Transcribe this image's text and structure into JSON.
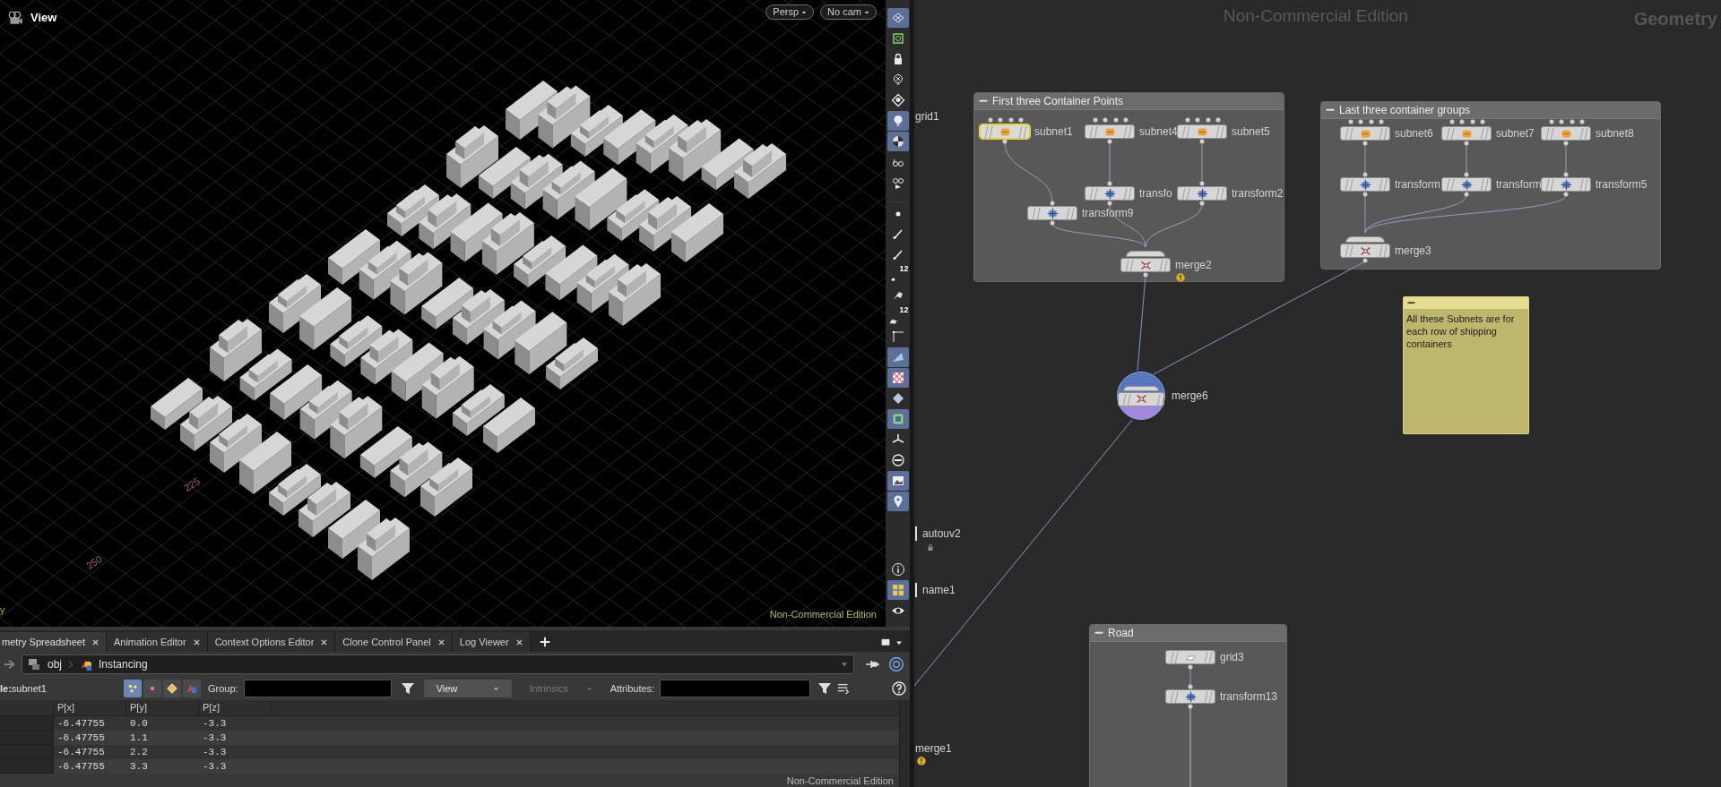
{
  "viewport": {
    "title": "View",
    "menus": [
      {
        "label": "Persp"
      },
      {
        "label": "No cam"
      }
    ],
    "grid_labels": [
      "225",
      "250"
    ],
    "axis_label": "y",
    "edition": "Non-Commercial Edition"
  },
  "toolbar": [
    {
      "kind": "display",
      "selected": true
    },
    {
      "kind": "snap",
      "selected": false
    },
    {
      "kind": "lock",
      "selected": false
    },
    {
      "kind": "light-off",
      "selected": false
    },
    {
      "kind": "light-diamond",
      "selected": false
    },
    {
      "kind": "light",
      "selected": true
    },
    {
      "kind": "sphere",
      "selected": true
    },
    {
      "kind": "glasses",
      "selected": false
    },
    {
      "kind": "glasses-play",
      "selected": false
    },
    {
      "kind": "dot",
      "selected": false
    },
    {
      "kind": "pen",
      "selected": false
    },
    {
      "kind": "pen",
      "selected": false
    },
    {
      "kind": "dot",
      "selected": false,
      "badge": "12"
    },
    {
      "kind": "brush",
      "selected": false
    },
    {
      "kind": "plane",
      "selected": false,
      "badge": "12"
    },
    {
      "kind": "corner",
      "selected": false
    },
    {
      "kind": "shard",
      "selected": true
    },
    {
      "kind": "checker",
      "selected": true
    },
    {
      "kind": "diamond",
      "selected": false
    },
    {
      "kind": "frame",
      "selected": true
    },
    {
      "kind": "axis",
      "selected": false
    },
    {
      "kind": "circle",
      "selected": false
    },
    {
      "kind": "picture",
      "selected": true
    },
    {
      "kind": "pin",
      "selected": true
    },
    {
      "kind": "info",
      "selected": false
    },
    {
      "kind": "layout",
      "selected": true
    },
    {
      "kind": "eye",
      "selected": false
    }
  ],
  "spreadsheet": {
    "tabs": [
      {
        "label": "metry Spreadsheet",
        "selected": true
      },
      {
        "label": "Animation Editor",
        "selected": false
      },
      {
        "label": "Context Options Editor",
        "selected": false
      },
      {
        "label": "Clone Control Panel",
        "selected": false
      },
      {
        "label": "Log Viewer",
        "selected": false
      }
    ],
    "path": [
      "obj",
      "Instancing"
    ],
    "node": "**le:**subnet1",
    "class_buttons": [
      {
        "kind": "points",
        "selected": true
      },
      {
        "kind": "vertices",
        "selected": false
      },
      {
        "kind": "primitives",
        "selected": false
      },
      {
        "kind": "detail",
        "selected": false
      }
    ],
    "group_label": "Group:",
    "view_menu": "View",
    "intrinsics_menu": "Intrinsics",
    "attributes_label": "Attributes:",
    "columns": [
      "P[x]",
      "P[y]",
      "P[z]"
    ],
    "rows": [
      [
        "-6.47755",
        "0.0",
        "-3.3"
      ],
      [
        "-6.47755",
        "1.1",
        "-3.3"
      ],
      [
        "-6.47755",
        "2.2",
        "-3.3"
      ],
      [
        "-6.47755",
        "3.3",
        "-3.3"
      ]
    ],
    "edition": "Non-Commercial Edition"
  },
  "network": {
    "edition": "Non-Commercial Edition",
    "context": "Geometry",
    "boxes": [
      {
        "title": "First three Container Points",
        "nodes": [
          {
            "label": "subnet1",
            "kind": "subnet",
            "selected": true
          },
          {
            "label": "subnet4",
            "kind": "subnet",
            "selected": false
          },
          {
            "label": "subnet5",
            "kind": "subnet",
            "selected": false
          },
          {
            "label": "transfo",
            "kind": "transform",
            "selected": false
          },
          {
            "label": "transform2",
            "kind": "transform",
            "selected": false
          },
          {
            "label": "transform9",
            "kind": "transform",
            "selected": false
          },
          {
            "label": "merge2",
            "kind": "merge",
            "selected": false,
            "warning": true
          }
        ]
      },
      {
        "title": "Last three container groups",
        "nodes": [
          {
            "label": "subnet6",
            "kind": "subnet",
            "selected": false
          },
          {
            "label": "subnet7",
            "kind": "subnet",
            "selected": false
          },
          {
            "label": "subnet8",
            "kind": "subnet",
            "selected": false
          },
          {
            "label": "transform",
            "kind": "transform",
            "selected": false
          },
          {
            "label": "transform",
            "kind": "transform",
            "selected": false
          },
          {
            "label": "transform5",
            "kind": "transform",
            "selected": false
          },
          {
            "label": "merge3",
            "kind": "merge",
            "selected": false
          }
        ]
      },
      {
        "title": "Road",
        "nodes": [
          {
            "label": "grid3",
            "kind": "grid",
            "selected": false
          },
          {
            "label": "transform13",
            "kind": "transform",
            "selected": false
          }
        ]
      }
    ],
    "nodes": [
      {
        "label": "grid1",
        "kind": "offscreen"
      },
      {
        "label": "merge6",
        "kind": "merge",
        "display": true
      },
      {
        "label": "autouv2",
        "kind": "edge",
        "locked": true
      },
      {
        "label": "name1",
        "kind": "edge"
      },
      {
        "label": "merge1",
        "kind": "offscreen",
        "warning": true
      }
    ],
    "note": {
      "text": "All these Subnets are for each row of shipping containers"
    }
  }
}
